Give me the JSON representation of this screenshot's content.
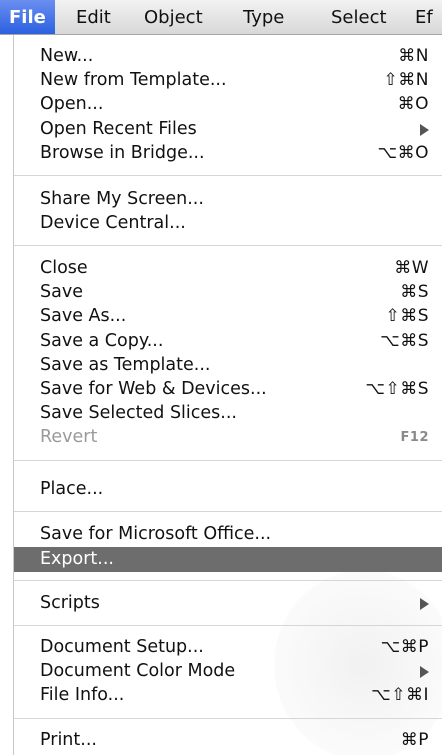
{
  "menubar": {
    "items": [
      {
        "label": "File",
        "active": true
      },
      {
        "label": "Edit"
      },
      {
        "label": "Object"
      },
      {
        "label": "Type"
      },
      {
        "label": "Select"
      },
      {
        "label": "Ef"
      }
    ]
  },
  "menu": {
    "group1": [
      {
        "label": "New...",
        "shortcut": "⌘N"
      },
      {
        "label": "New from Template...",
        "shortcut": "⇧⌘N"
      },
      {
        "label": "Open...",
        "shortcut": "⌘O"
      },
      {
        "label": "Open Recent Files",
        "submenu": true
      },
      {
        "label": "Browse in Bridge...",
        "shortcut": "⌥⌘O"
      }
    ],
    "group2": [
      {
        "label": "Share My Screen..."
      },
      {
        "label": "Device Central..."
      }
    ],
    "group3": [
      {
        "label": "Close",
        "shortcut": "⌘W"
      },
      {
        "label": "Save",
        "shortcut": "⌘S"
      },
      {
        "label": "Save As...",
        "shortcut": "⇧⌘S"
      },
      {
        "label": "Save a Copy...",
        "shortcut": "⌥⌘S"
      },
      {
        "label": "Save as Template..."
      },
      {
        "label": "Save for Web & Devices...",
        "shortcut": "⌥⇧⌘S"
      },
      {
        "label": "Save Selected Slices..."
      },
      {
        "label": "Revert",
        "shortcut": "F12",
        "disabled": true
      }
    ],
    "group4": [
      {
        "label": "Place..."
      }
    ],
    "group5": [
      {
        "label": "Save for Microsoft Office..."
      },
      {
        "label": "Export...",
        "highlighted": true
      }
    ],
    "group6": [
      {
        "label": "Scripts",
        "submenu": true
      }
    ],
    "group7": [
      {
        "label": "Document Setup...",
        "shortcut": "⌥⌘P"
      },
      {
        "label": "Document Color Mode",
        "submenu": true
      },
      {
        "label": "File Info...",
        "shortcut": "⌥⇧⌘I"
      }
    ],
    "group8": [
      {
        "label": "Print...",
        "shortcut": "⌘P"
      }
    ]
  },
  "colors": {
    "active_menu": "#2a5fe0",
    "highlight_row": "#6d6d6d",
    "disabled_text": "#9a9a9a"
  }
}
